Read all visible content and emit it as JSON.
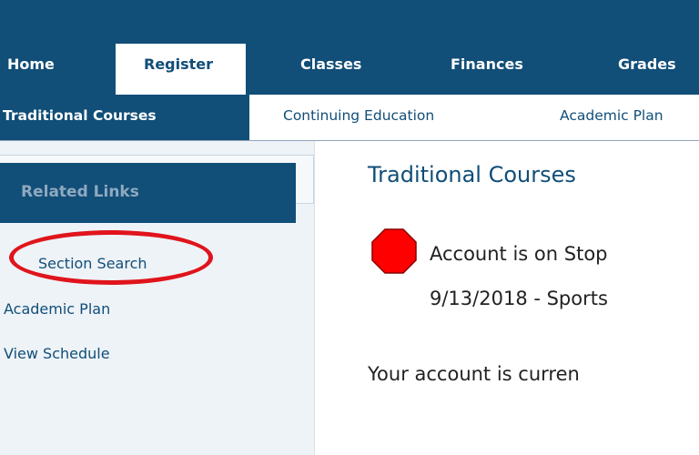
{
  "nav": {
    "tabs": [
      {
        "label": "Home"
      },
      {
        "label": "Register",
        "active": true
      },
      {
        "label": "Classes"
      },
      {
        "label": "Finances"
      },
      {
        "label": "Grades"
      }
    ],
    "subtabs": [
      {
        "label": "Traditional Courses",
        "active": true
      },
      {
        "label": "Continuing Education"
      },
      {
        "label": "Academic Plan"
      }
    ]
  },
  "sidebar": {
    "header": "Related Links",
    "links": [
      {
        "label": "Section Search",
        "highlighted": true
      },
      {
        "label": "Academic Plan"
      },
      {
        "label": "View Schedule"
      }
    ]
  },
  "main": {
    "title": "Traditional Courses",
    "stop_icon": "stop-sign-icon",
    "stop_line_1": "Account is on Stop",
    "stop_line_2": "9/13/2018 - Sports",
    "account_status": "Your account is curren"
  },
  "colors": {
    "nav_bg": "#114e78",
    "highlight": "#e0141c",
    "stop_red": "#ff0000"
  }
}
